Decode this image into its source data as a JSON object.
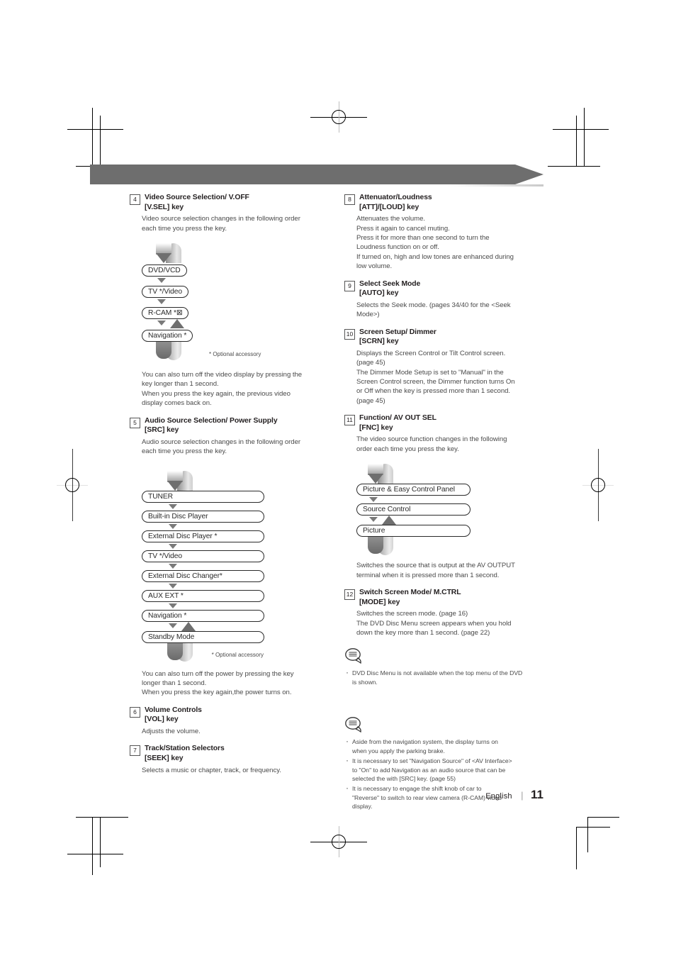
{
  "page": {
    "language": "English",
    "number": "11",
    "separator": "|"
  },
  "left_column": {
    "items": [
      {
        "num": "4",
        "title_line1": "Video Source Selection/ V.OFF",
        "title_line2": "[V.SEL] key",
        "intro": [
          "Video source selection changes in the following order",
          "each time you press the key."
        ],
        "flow": {
          "boxes": [
            "DVD/VCD",
            "TV */Video",
            "R-CAM *⊠",
            "Navigation *"
          ],
          "footnote": "* Optional accessory"
        },
        "outro": [
          "You can also turn off the video display by pressing the",
          "key longer than 1 second.",
          "When you press the key again, the previous video",
          "display comes back on."
        ]
      },
      {
        "num": "5",
        "title_line1": "Audio Source Selection/ Power Supply",
        "title_line2": "[SRC] key",
        "intro": [
          "Audio source selection changes in the following order",
          "each time you press the key."
        ],
        "flow": {
          "boxes": [
            "TUNER",
            "Built-in Disc Player",
            "External Disc Player *",
            "TV */Video",
            "External Disc Changer*",
            "AUX EXT *",
            "Navigation *",
            "Standby Mode"
          ],
          "footnote": "* Optional accessory"
        },
        "outro": [
          "You can also turn off the power by pressing the key",
          "longer than 1 second.",
          "When you press the key again,the power turns on."
        ]
      },
      {
        "num": "6",
        "title_line1": "Volume Controls",
        "title_line2": "[VOL] key",
        "intro": [
          "Adjusts the volume."
        ]
      },
      {
        "num": "7",
        "title_line1": "Track/Station Selectors",
        "title_line2": "[SEEK] key",
        "intro": [
          "Selects a music or chapter, track, or frequency."
        ]
      }
    ]
  },
  "right_column": {
    "items": [
      {
        "num": "8",
        "title_line1": "Attenuator/Loudness",
        "title_line2": "[ATT]/[LOUD] key",
        "intro": [
          "Attenuates the volume.",
          "Press it again to cancel muting.",
          "Press it for more than one second to turn the",
          "Loudness function on or off.",
          "If turned on, high and low tones are enhanced during",
          "low volume."
        ]
      },
      {
        "num": "9",
        "title_line1": "Select Seek Mode",
        "title_line2": "[AUTO] key",
        "intro": [
          "Selects the Seek mode. (pages 34/40 for the <Seek",
          "Mode>)"
        ]
      },
      {
        "num": "10",
        "title_line1": "Screen Setup/ Dimmer",
        "title_line2": "[SCRN] key",
        "intro": [
          "Displays the Screen Control or Tilt Control screen.",
          "(page 45)",
          "The Dimmer Mode Setup is set to  \"Manual\" in the",
          "Screen Control screen, the Dimmer function turns On",
          "or Off when the key is pressed more than 1 second.",
          "(page 45)"
        ]
      },
      {
        "num": "11",
        "title_line1": "Function/ AV OUT SEL",
        "title_line2": "[FNC] key",
        "intro": [
          "The video source function changes in the following",
          "order each time you press the key."
        ],
        "flow": {
          "boxes": [
            "Picture & Easy Control Panel",
            "Source Control",
            "Picture"
          ]
        },
        "outro": [
          "Switches the source that is output at the AV OUTPUT",
          "terminal when it is pressed more than 1 second."
        ]
      },
      {
        "num": "12",
        "title_line1": "Switch Screen Mode/ M.CTRL",
        "title_line2": "[MODE] key",
        "intro": [
          "Switches the screen mode. (page 16)",
          "The DVD Disc Menu screen appears when you hold",
          "down the key more than 1 second. (page 22)"
        ]
      }
    ],
    "note1": {
      "icon": "note-bubble-icon",
      "bullets": [
        [
          "DVD Disc Menu is not available when the top menu of the DVD",
          "is shown."
        ]
      ]
    },
    "note2": {
      "icon": "note-bubble-icon",
      "bullets": [
        [
          "Aside from the navigation system, the display  turns on",
          "when you apply the parking brake."
        ],
        [
          "It is necessary to set \"Navigation Source\" of <AV Interface>",
          "to \"On\" to add Navigation as an audio source that can be",
          "selected the with [SRC] key. (page 55)"
        ],
        [
          "It is necessary to engage the shift knob of car to",
          "\"Reverse\" to switch to rear view camera (R-CAM) video",
          "display."
        ]
      ]
    }
  },
  "colors": {
    "banner": "#6e6e6e",
    "text": "#231f20",
    "body_text": "#4a4a4a",
    "arrow": "#7a7a7a"
  }
}
